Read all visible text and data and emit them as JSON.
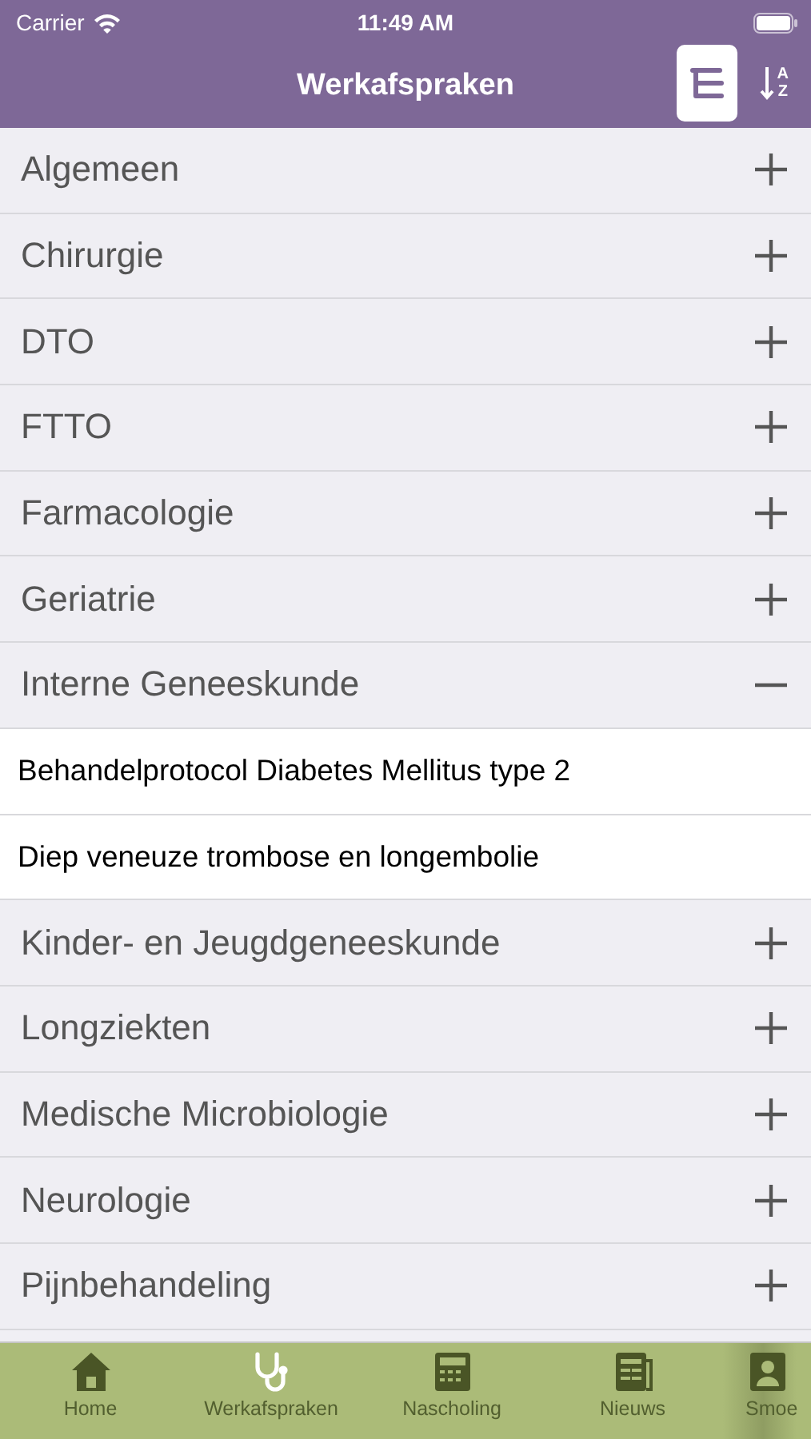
{
  "status_bar": {
    "carrier": "Carrier",
    "time": "11:49 AM"
  },
  "nav_bar": {
    "title": "Werkafspraken",
    "view_toggle": {
      "selected": true
    },
    "sort_button": {
      "letter_top": "A",
      "letter_bottom": "Z"
    }
  },
  "groups": [
    {
      "label": "Algemeen",
      "expanded": false
    },
    {
      "label": "Chirurgie",
      "expanded": false
    },
    {
      "label": "DTO",
      "expanded": false
    },
    {
      "label": "FTTO",
      "expanded": false
    },
    {
      "label": "Farmacologie",
      "expanded": false
    },
    {
      "label": "Geriatrie",
      "expanded": false
    },
    {
      "label": "Interne Geneeskunde",
      "expanded": true,
      "children": [
        {
          "label": "Behandelprotocol Diabetes Mellitus type 2"
        },
        {
          "label": "Diep veneuze trombose en longembolie"
        }
      ]
    },
    {
      "label": "Kinder- en Jeugdgeneeskunde",
      "expanded": false
    },
    {
      "label": "Longziekten",
      "expanded": false
    },
    {
      "label": "Medische Microbiologie",
      "expanded": false
    },
    {
      "label": "Neurologie",
      "expanded": false
    },
    {
      "label": "Pijnbehandeling",
      "expanded": false
    }
  ],
  "tab_bar": [
    {
      "label": "Home",
      "kind": "home",
      "selected": false
    },
    {
      "label": "Werkafspraken",
      "kind": "stethoscope",
      "selected": true
    },
    {
      "label": "Nascholing",
      "kind": "calculator",
      "selected": false
    },
    {
      "label": "Nieuws",
      "kind": "newspaper",
      "selected": false
    },
    {
      "label": "Smoe",
      "kind": "person",
      "selected": false
    }
  ]
}
